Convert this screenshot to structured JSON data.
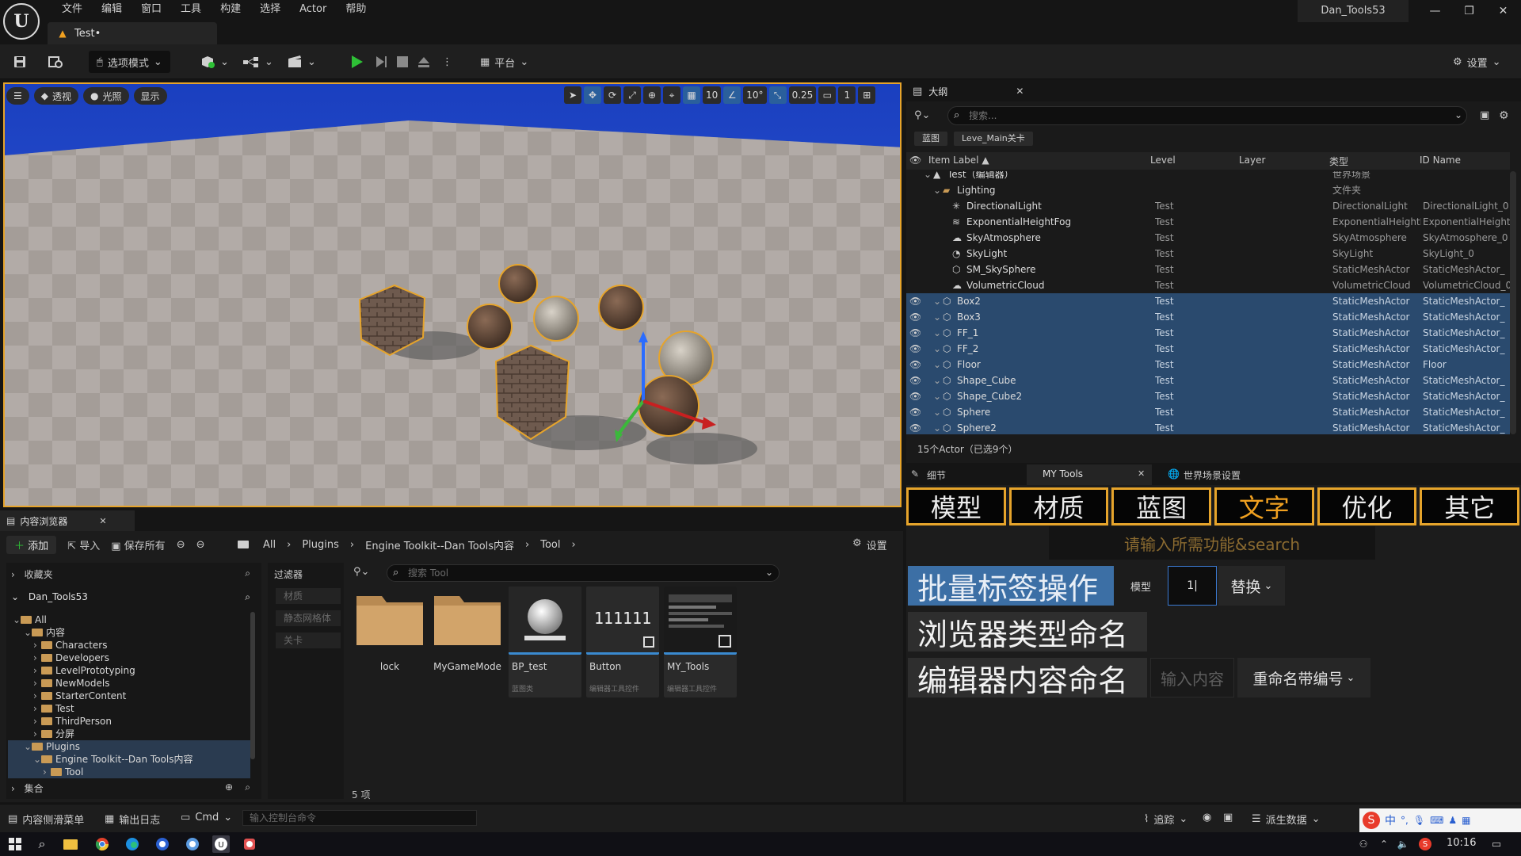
{
  "app": {
    "logo_letter": "U",
    "menu": [
      "文件",
      "编辑",
      "窗口",
      "工具",
      "构建",
      "选择",
      "Actor",
      "帮助"
    ],
    "project_name": "Dan_Tools53",
    "window_buttons": [
      "—",
      "❐",
      "✕"
    ]
  },
  "tab": {
    "label": "Test•"
  },
  "toolbar": {
    "mode_label": "选项模式",
    "platform_label": "平台",
    "settings_label": "设置"
  },
  "viewport": {
    "left_pills": [
      "透视",
      "光照",
      "显示"
    ],
    "grid_value": "10",
    "angle_value": "10°",
    "scale_value": "0.25",
    "camera_value": "1"
  },
  "outliner": {
    "title": "大纲",
    "search_placeholder": "搜索...",
    "chips": [
      "蓝图",
      "Leve_Main关卡"
    ],
    "columns": {
      "label": "Item Label ▲",
      "level": "Level",
      "layer": "Layer",
      "type": "类型",
      "id": "ID Name"
    },
    "rows": [
      {
        "label": "Test（编辑器）",
        "level": "",
        "type": "世界场景",
        "id": "",
        "indent": 0,
        "icon": "world-icon",
        "selected": false,
        "eye": false
      },
      {
        "label": "Lighting",
        "level": "",
        "type": "文件夹",
        "id": "",
        "indent": 1,
        "icon": "folder-icon",
        "selected": false,
        "eye": false
      },
      {
        "label": "DirectionalLight",
        "level": "Test",
        "type": "DirectionalLight",
        "id": "DirectionalLight_0",
        "indent": 2,
        "icon": "light-icon",
        "selected": false,
        "eye": false
      },
      {
        "label": "ExponentialHeightFog",
        "level": "Test",
        "type": "ExponentialHeightF",
        "id": "ExponentialHeight",
        "indent": 2,
        "icon": "fog-icon",
        "selected": false,
        "eye": false
      },
      {
        "label": "SkyAtmosphere",
        "level": "Test",
        "type": "SkyAtmosphere",
        "id": "SkyAtmosphere_0",
        "indent": 2,
        "icon": "atmosphere-icon",
        "selected": false,
        "eye": false
      },
      {
        "label": "SkyLight",
        "level": "Test",
        "type": "SkyLight",
        "id": "SkyLight_0",
        "indent": 2,
        "icon": "skylight-icon",
        "selected": false,
        "eye": false
      },
      {
        "label": "SM_SkySphere",
        "level": "Test",
        "type": "StaticMeshActor",
        "id": "StaticMeshActor_",
        "indent": 2,
        "icon": "mesh-icon",
        "selected": false,
        "eye": false
      },
      {
        "label": "VolumetricCloud",
        "level": "Test",
        "type": "VolumetricCloud",
        "id": "VolumetricCloud_0",
        "indent": 2,
        "icon": "cloud-icon",
        "selected": false,
        "eye": false
      },
      {
        "label": "Box2",
        "level": "Test",
        "type": "StaticMeshActor",
        "id": "StaticMeshActor_",
        "indent": 1,
        "icon": "mesh-icon",
        "selected": true,
        "eye": true
      },
      {
        "label": "Box3",
        "level": "Test",
        "type": "StaticMeshActor",
        "id": "StaticMeshActor_",
        "indent": 1,
        "icon": "mesh-icon",
        "selected": true,
        "eye": true
      },
      {
        "label": "FF_1",
        "level": "Test",
        "type": "StaticMeshActor",
        "id": "StaticMeshActor_",
        "indent": 1,
        "icon": "mesh-icon",
        "selected": true,
        "eye": true
      },
      {
        "label": "FF_2",
        "level": "Test",
        "type": "StaticMeshActor",
        "id": "StaticMeshActor_",
        "indent": 1,
        "icon": "mesh-icon",
        "selected": true,
        "eye": true
      },
      {
        "label": "Floor",
        "level": "Test",
        "type": "StaticMeshActor",
        "id": "Floor",
        "indent": 1,
        "icon": "mesh-icon",
        "selected": true,
        "eye": true
      },
      {
        "label": "Shape_Cube",
        "level": "Test",
        "type": "StaticMeshActor",
        "id": "StaticMeshActor_",
        "indent": 1,
        "icon": "mesh-icon",
        "selected": true,
        "eye": true
      },
      {
        "label": "Shape_Cube2",
        "level": "Test",
        "type": "StaticMeshActor",
        "id": "StaticMeshActor_",
        "indent": 1,
        "icon": "mesh-icon",
        "selected": true,
        "eye": true
      },
      {
        "label": "Sphere",
        "level": "Test",
        "type": "StaticMeshActor",
        "id": "StaticMeshActor_",
        "indent": 1,
        "icon": "mesh-icon",
        "selected": true,
        "eye": true
      },
      {
        "label": "Sphere2",
        "level": "Test",
        "type": "StaticMeshActor",
        "id": "StaticMeshActor_",
        "indent": 1,
        "icon": "mesh-icon",
        "selected": true,
        "eye": true
      }
    ],
    "footer": "15个Actor（已选9个）"
  },
  "details": {
    "tabs": [
      "细节",
      "MY Tools",
      "世界场景设置"
    ]
  },
  "mytools": {
    "categories": [
      "模型",
      "材质",
      "蓝图",
      "文字",
      "优化",
      "其它"
    ],
    "active_category": "文字",
    "search_hint": "请输入所需功能&search",
    "batch_label": "批量标签操作",
    "batch_target": "模型",
    "batch_value": "1|",
    "batch_mode": "替换",
    "browser_rename": "浏览器类型命名",
    "editor_rename": "编辑器内容命名",
    "editor_input_placeholder": "输入内容",
    "editor_mode": "重命名带编号"
  },
  "content_browser": {
    "title": "内容浏览器",
    "add_label": "添加",
    "import_label": "导入",
    "save_label": "保存所有",
    "settings_label": "设置",
    "breadcrumbs": [
      "All",
      "Plugins",
      "Engine Toolkit--Dan Tools内容",
      "Tool"
    ],
    "favorites_label": "收藏夹",
    "project_label": "Dan_Tools53",
    "collections_label": "集合",
    "filters_label": "过滤器",
    "filter_items": [
      "材质",
      "静态网格体",
      "关卡"
    ],
    "search_placeholder": "搜索 Tool",
    "tree": [
      "All",
      "内容",
      "Characters",
      "Developers",
      "LevelPrototyping",
      "NewModels",
      "StarterContent",
      "Test",
      "ThirdPerson",
      "分屏",
      "Plugins",
      "Engine Toolkit--Dan Tools内容",
      "Tool"
    ],
    "assets": [
      {
        "name": "lock",
        "sub": "",
        "kind": "folder"
      },
      {
        "name": "MyGameMode",
        "sub": "",
        "kind": "folder"
      },
      {
        "name": "BP_test",
        "sub": "蓝图类",
        "kind": "blueprint"
      },
      {
        "name": "Button",
        "sub": "编辑器工具控件",
        "kind": "widget",
        "thumb_text": "111111"
      },
      {
        "name": "MY_Tools",
        "sub": "编辑器工具控件",
        "kind": "widget2"
      }
    ],
    "item_count": "5 项"
  },
  "statusbar": {
    "drawer_label": "内容侧滑菜单",
    "log_label": "输出日志",
    "cmd_label": "Cmd",
    "cmd_placeholder": "输入控制台命令",
    "trace_label": "追踪",
    "derived_label": "派生数据"
  },
  "taskbar": {
    "time": "10:16",
    "ime": "中"
  }
}
